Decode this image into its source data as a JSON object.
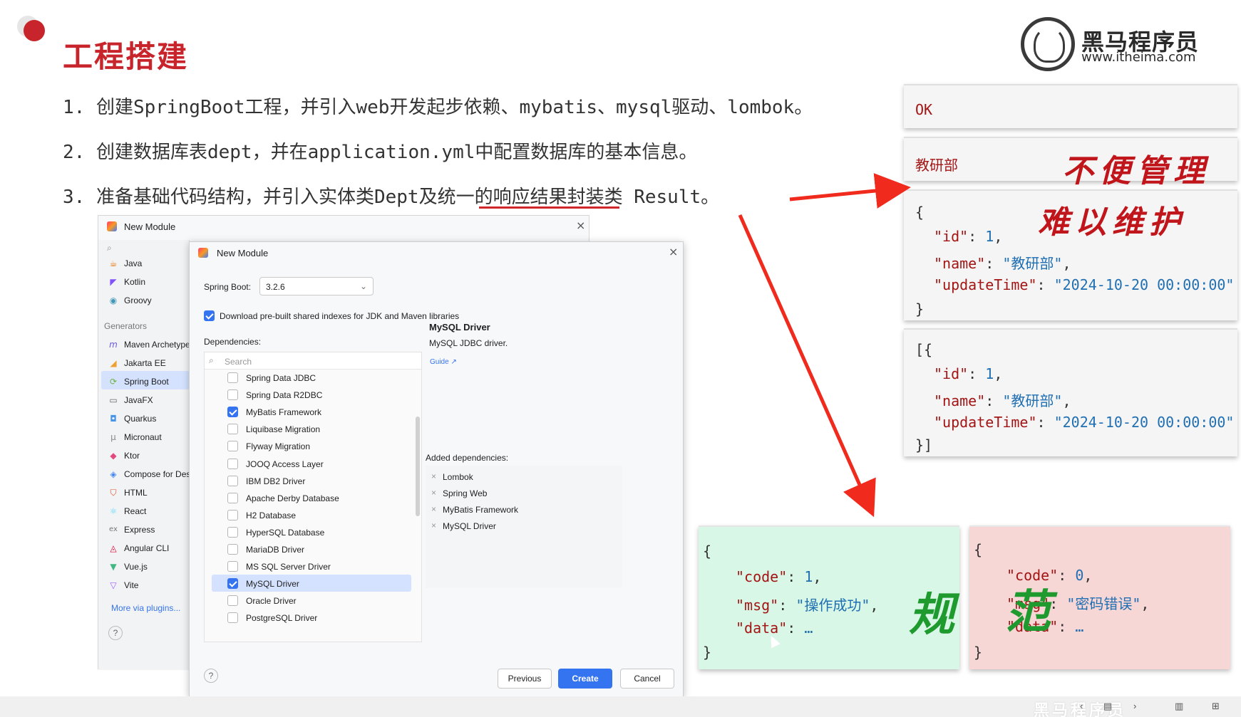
{
  "slide": {
    "title": "工程搭建",
    "logo_name": "黑马程序员",
    "logo_url": "www.itheima.com",
    "steps": [
      "1. 创建SpringBoot工程，并引入web开发起步依赖、mybatis、mysql驱动、lombok。",
      "2. 创建数据库表dept，并在application.yml中配置数据库的基本信息。",
      "3. 准备基础代码结构，并引入实体类Dept及统一的响应结果封装类 Result。"
    ],
    "calligraphy": {
      "bubian": "不便管理",
      "nanyi": "难以维护",
      "gui": "规",
      "fan": "范"
    },
    "watermark": "黑马程序员"
  },
  "cards": {
    "ok_text": "OK",
    "dept_text": "教研部",
    "obj": {
      "open": "{",
      "id_key": "\"id\"",
      "id_val": "1",
      "name_key": "\"name\"",
      "name_val": "\"教研部\"",
      "time_key": "\"updateTime\"",
      "time_val": "\"2024-10-20 00:00:00\"",
      "close": "}"
    },
    "arr": {
      "open": "[{",
      "close": "}]"
    }
  },
  "results": {
    "success": {
      "open": "{",
      "code_key": "\"code\"",
      "code_val": "1",
      "msg_key": "\"msg\"",
      "msg_val": "\"操作成功\"",
      "data_key": "\"data\"",
      "data_val": "…",
      "close": "}"
    },
    "error": {
      "open": "{",
      "code_key": "\"code\"",
      "code_val": "0",
      "msg_key": "\"msg\"",
      "msg_val": "\"密码错误\"",
      "data_key": "\"data\"",
      "data_val": "…",
      "close": "}"
    }
  },
  "back_dialog": {
    "title": "New Module",
    "languages": [
      "Java",
      "Kotlin",
      "Groovy"
    ],
    "generators_header": "Generators",
    "generators": [
      "Maven Archetype",
      "Jakarta EE",
      "Spring Boot",
      "JavaFX",
      "Quarkus",
      "Micronaut",
      "Ktor",
      "Compose for Desktop",
      "HTML",
      "React",
      "Express",
      "Angular CLI",
      "Vue.js",
      "Vite"
    ],
    "selected_generator": "Spring Boot",
    "more_plugins": "More via plugins...",
    "help": "?"
  },
  "front_dialog": {
    "title": "New Module",
    "spring_boot_label": "Spring Boot:",
    "spring_boot_version": "3.2.6",
    "download_indexes_label": "Download pre-built shared indexes for JDK and Maven libraries",
    "dependencies_label": "Dependencies:",
    "search_placeholder": "Search",
    "dependencies": [
      {
        "label": "Spring Data JDBC",
        "checked": false
      },
      {
        "label": "Spring Data R2DBC",
        "checked": false
      },
      {
        "label": "MyBatis Framework",
        "checked": true
      },
      {
        "label": "Liquibase Migration",
        "checked": false
      },
      {
        "label": "Flyway Migration",
        "checked": false
      },
      {
        "label": "JOOQ Access Layer",
        "checked": false
      },
      {
        "label": "IBM DB2 Driver",
        "checked": false
      },
      {
        "label": "Apache Derby Database",
        "checked": false
      },
      {
        "label": "H2 Database",
        "checked": false
      },
      {
        "label": "HyperSQL Database",
        "checked": false
      },
      {
        "label": "MariaDB Driver",
        "checked": false
      },
      {
        "label": "MS SQL Server Driver",
        "checked": false
      },
      {
        "label": "MySQL Driver",
        "checked": true
      },
      {
        "label": "Oracle Driver",
        "checked": false
      },
      {
        "label": "PostgreSQL Driver",
        "checked": false
      }
    ],
    "detail_title": "MySQL Driver",
    "detail_desc": "MySQL JDBC driver.",
    "detail_guide": "Guide ↗",
    "added_label": "Added dependencies:",
    "added": [
      "Lombok",
      "Spring Web",
      "MyBatis Framework",
      "MySQL Driver"
    ],
    "btn_previous": "Previous",
    "btn_create": "Create",
    "btn_cancel": "Cancel",
    "help": "?"
  },
  "colors": {
    "accent_red": "#c8242b",
    "ide_blue": "#3574f0",
    "success_bg": "#d9f7e6",
    "error_bg": "#f7d6d6"
  }
}
